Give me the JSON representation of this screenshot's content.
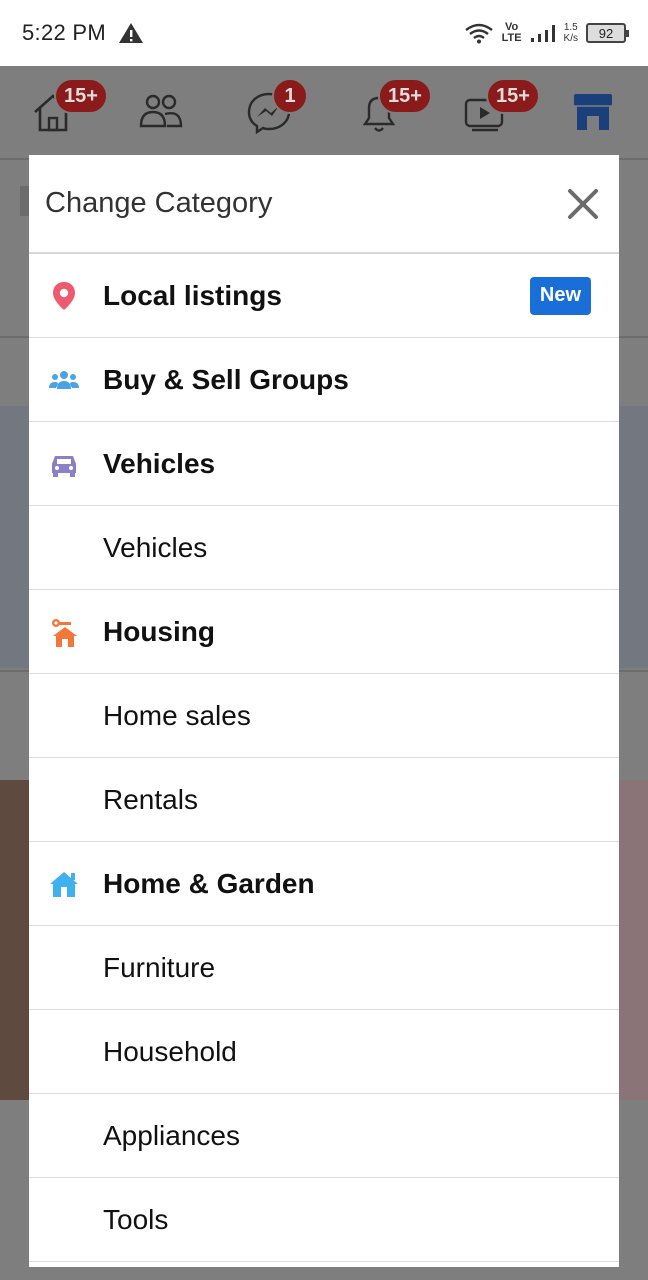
{
  "status_bar": {
    "time": "5:22 PM",
    "network_line1": "Vo",
    "network_line2": "LTE",
    "speed_value": "1.5",
    "speed_unit": "K/s",
    "battery": "92"
  },
  "top_nav": {
    "home_badge": "15+",
    "messenger_badge": "1",
    "notifications_badge": "15+",
    "watch_badge": "15+",
    "accent_color": "#1a6ed8"
  },
  "modal": {
    "title": "Change Category",
    "items": [
      {
        "label": "Local listings",
        "bold": true,
        "icon": "location-pin-icon",
        "badge": "New"
      },
      {
        "label": "Buy & Sell Groups",
        "bold": true,
        "icon": "groups-icon"
      },
      {
        "label": "Vehicles",
        "bold": true,
        "icon": "car-icon"
      },
      {
        "label": "Vehicles",
        "bold": false
      },
      {
        "label": "Housing",
        "bold": true,
        "icon": "house-key-icon"
      },
      {
        "label": "Home sales",
        "bold": false
      },
      {
        "label": "Rentals",
        "bold": false
      },
      {
        "label": "Home & Garden",
        "bold": true,
        "icon": "home-icon"
      },
      {
        "label": "Furniture",
        "bold": false
      },
      {
        "label": "Household",
        "bold": false
      },
      {
        "label": "Appliances",
        "bold": false
      },
      {
        "label": "Tools",
        "bold": false
      }
    ]
  },
  "colors": {
    "badge_blue": "#1a6ed8",
    "pin_red": "#ef5a6f",
    "groups_blue": "#4ba3e3",
    "car_purple": "#8a7fc8",
    "housing_orange": "#f3773a",
    "home_blue": "#3fb0f0"
  }
}
